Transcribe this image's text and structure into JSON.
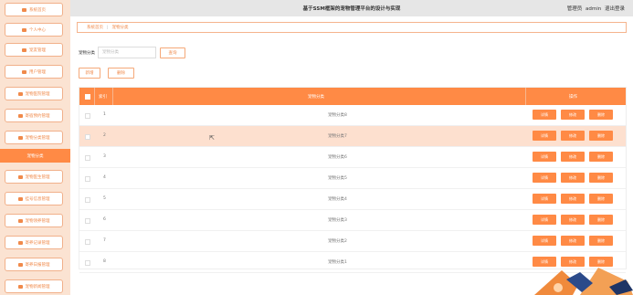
{
  "header": {
    "title": "基于SSM框架的宠物管理平台的设计与实现",
    "user_prefix": "管理员",
    "user_name": "admin",
    "logout": "退出登录"
  },
  "sidebar": {
    "items": [
      {
        "label": "系统首页"
      },
      {
        "label": "个人中心"
      },
      {
        "label": "宠友管理"
      },
      {
        "label": "用户管理"
      },
      {
        "label": "宠物医院管理"
      },
      {
        "label": "寄宿预约管理"
      },
      {
        "label": "宠物分类管理"
      },
      {
        "label": "宠物分类"
      },
      {
        "label": "宠物医生管理"
      },
      {
        "label": "挂号信息管理"
      },
      {
        "label": "宠物领养管理"
      },
      {
        "label": "寄养记录管理"
      },
      {
        "label": "寄养日报管理"
      },
      {
        "label": "宠物新闻管理"
      }
    ]
  },
  "breadcrumb": {
    "home": "系统首页",
    "current": "宠物分类"
  },
  "search": {
    "label": "宠物分类",
    "placeholder": "宠物分类",
    "button": "查询"
  },
  "actions": {
    "add": "新增",
    "delete": "删除"
  },
  "table": {
    "columns": {
      "index": "索引",
      "name": "宠物分类",
      "ops": "操作"
    },
    "row_buttons": {
      "detail": "详情",
      "edit": "修改",
      "delete": "删除"
    },
    "rows": [
      {
        "index": "1",
        "name": "宠物分类8"
      },
      {
        "index": "2",
        "name": "宠物分类7"
      },
      {
        "index": "3",
        "name": "宠物分类6"
      },
      {
        "index": "4",
        "name": "宠物分类5"
      },
      {
        "index": "5",
        "name": "宠物分类4"
      },
      {
        "index": "6",
        "name": "宠物分类3"
      },
      {
        "index": "7",
        "name": "宠物分类2"
      },
      {
        "index": "8",
        "name": "宠物分类1"
      }
    ]
  },
  "colors": {
    "accent": "#ff8a45",
    "sidebar_bg": "#fbe3d2",
    "highlight_row": "#fde0cf"
  }
}
